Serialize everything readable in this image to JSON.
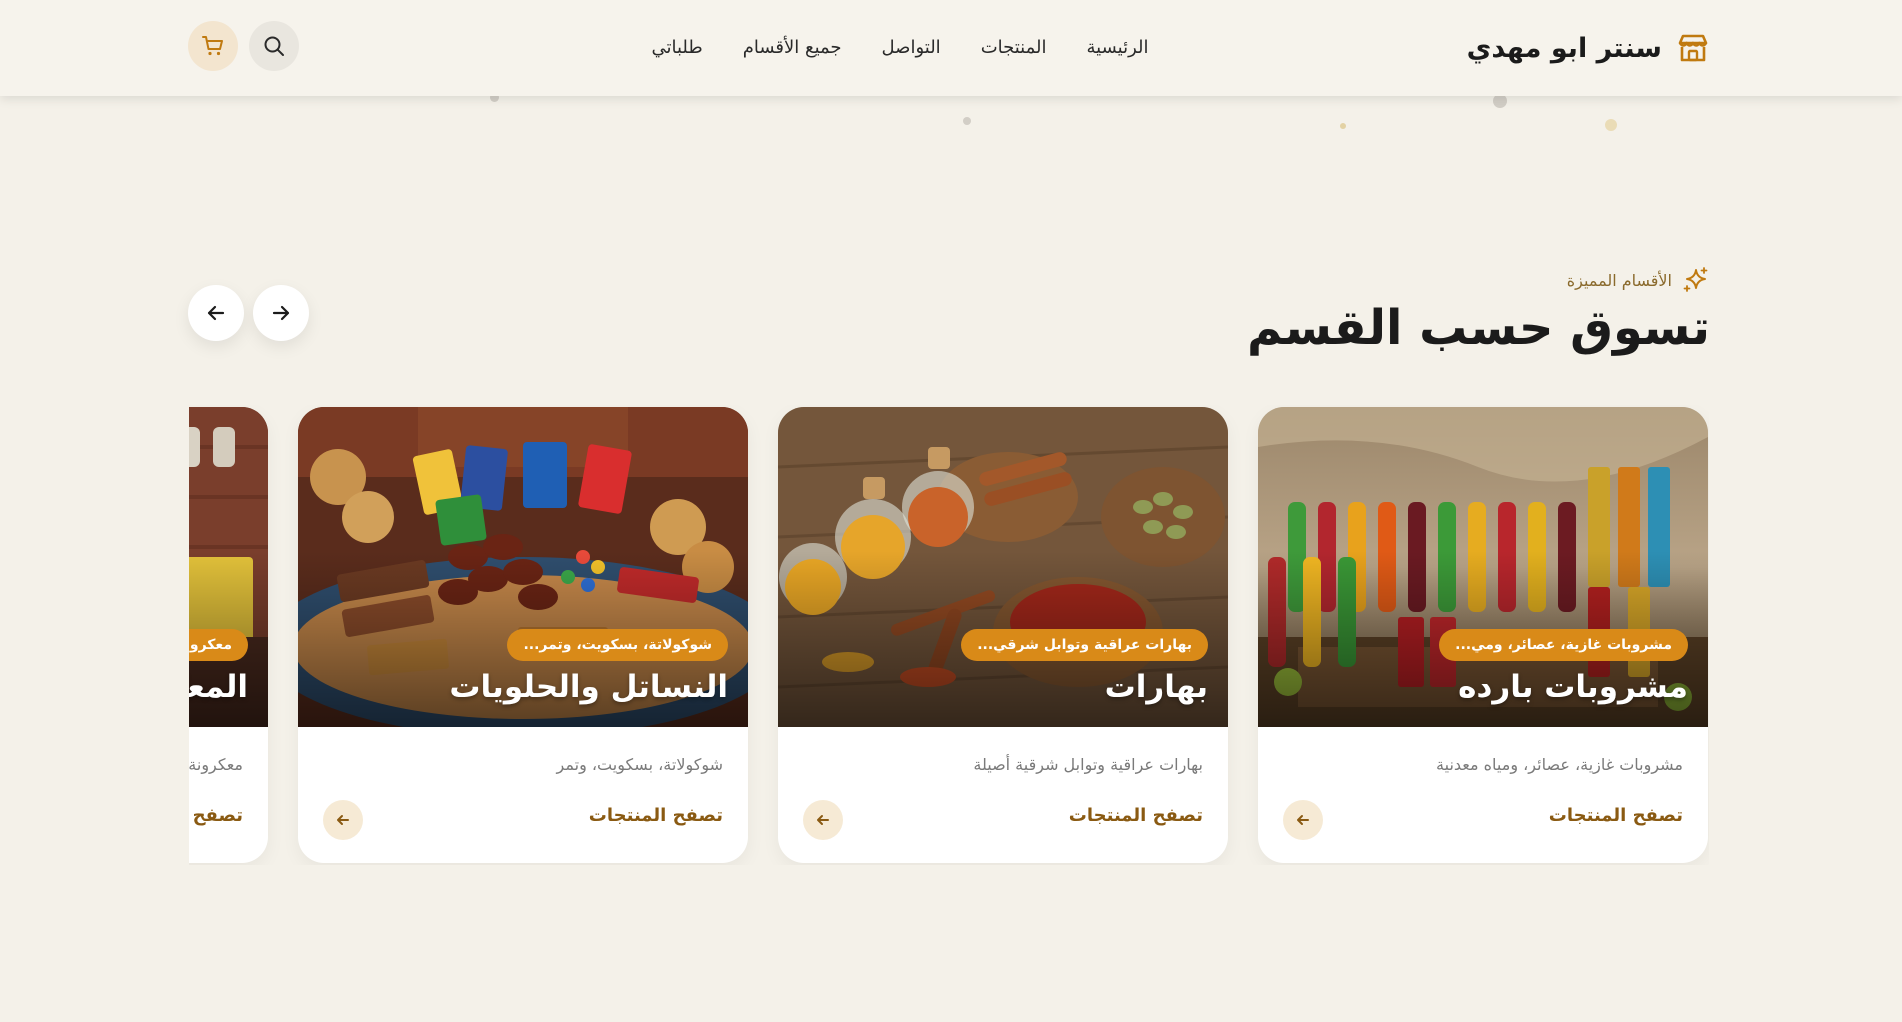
{
  "header": {
    "brand_name": "سنتر ابو مهدي",
    "nav": [
      "الرئيسية",
      "المنتجات",
      "التواصل",
      "جميع الأقسام",
      "طلباتي"
    ]
  },
  "section": {
    "eyebrow": "الأقسام المميزة",
    "title": "تسوق حسب القسم"
  },
  "cards": [
    {
      "badge": "مشروبات غازية، عصائر، ومي...",
      "title": "مشروبات بارده",
      "description": "مشروبات غازية، عصائر، ومياه معدنية",
      "link": "تصفح المنتجات"
    },
    {
      "badge": "بهارات عراقية وتوابل شرقي...",
      "title": "بهارات",
      "description": "بهارات عراقية وتوابل شرقية أصيلة",
      "link": "تصفح المنتجات"
    },
    {
      "badge": "شوكولاتة، بسكويت، وتمر...",
      "title": "النساتل والحلويات",
      "description": "شوكولاتة، بسكويت، وتمر",
      "link": "تصفح المنتجات"
    },
    {
      "badge": "معكرونة...",
      "title": "المعكرونة",
      "description": "معكرونة",
      "link": "تصفح المنتجات"
    }
  ],
  "colors": {
    "background": "#f4f1e9",
    "accent": "#d98a18",
    "link": "#8a5a12",
    "brand_icon": "#c07a10"
  },
  "icons": {
    "brand": "store-icon",
    "search": "search-icon",
    "cart": "cart-icon",
    "eyebrow": "sparkle-icon",
    "prev": "arrow-left-icon",
    "next": "arrow-right-icon",
    "card_arrow": "arrow-left-icon"
  }
}
